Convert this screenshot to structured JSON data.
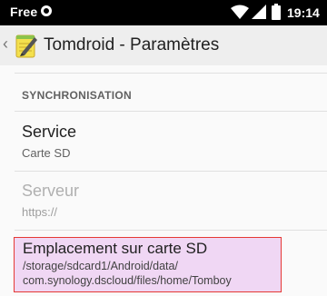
{
  "status_bar": {
    "carrier": "Free",
    "time": "19:14",
    "icons": [
      "notification-circle-icon",
      "wifi-icon",
      "signal-icon",
      "battery-icon"
    ]
  },
  "action_bar": {
    "title": "Tomdroid - Paramètres",
    "back_icon": "chevron-left-icon",
    "app_icon": "tomdroid-notepad-icon"
  },
  "section": {
    "header": "SYNCHRONISATION"
  },
  "preferences": [
    {
      "title": "Service",
      "summary": "Carte SD",
      "enabled": true
    },
    {
      "title": "Serveur",
      "summary": "https://",
      "enabled": false
    }
  ],
  "highlighted_preference": {
    "title": "Emplacement sur carte SD",
    "summary_line1": "/storage/sdcard1/Android/data/",
    "summary_line2": "com.synology.dscloud/files/home/Tomboy",
    "highlight_color": "#f0d7f4",
    "border_color": "#e53935"
  }
}
